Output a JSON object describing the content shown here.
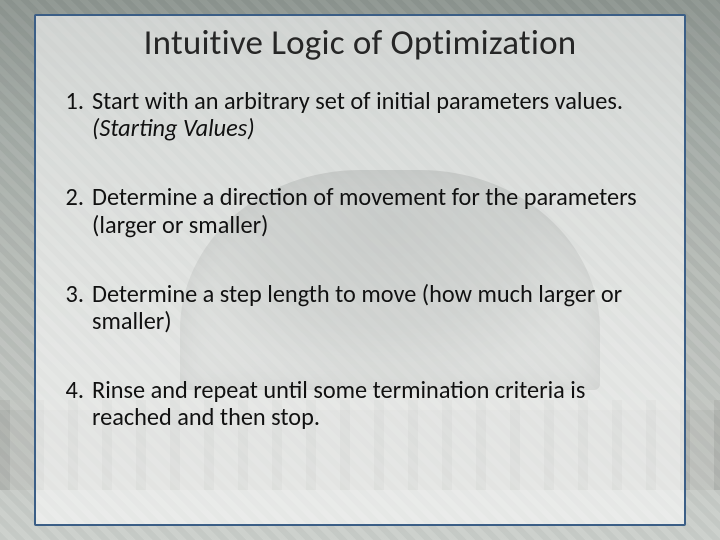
{
  "slide": {
    "title": "Intuitive Logic of Optimization",
    "items": [
      {
        "text": "Start with an arbitrary set of initial parameters values.",
        "subnote": "(Starting Values)"
      },
      {
        "text": "Determine a direction of movement for the parameters (larger or smaller)"
      },
      {
        "text": "Determine a step length to move (how much larger or smaller)"
      },
      {
        "text": "Rinse and repeat until some termination criteria  is reached and then stop."
      }
    ]
  },
  "colors": {
    "border": "#3b5e86",
    "overlay": "rgba(255,255,255,0.58)"
  }
}
